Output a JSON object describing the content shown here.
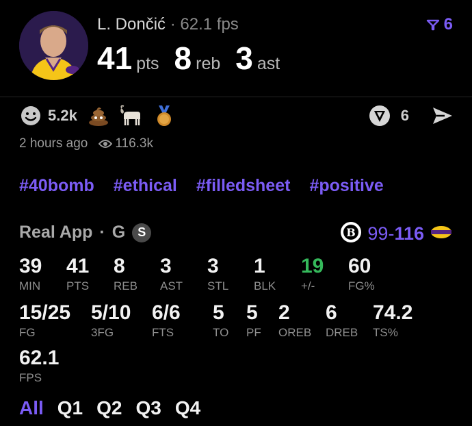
{
  "header": {
    "player_name": "L. Dončić",
    "separator": "·",
    "fps": "62.1 fps",
    "filter_count": "6",
    "statline": [
      {
        "value": "41",
        "label": "pts"
      },
      {
        "value": "8",
        "label": "reb"
      },
      {
        "value": "3",
        "label": "ast"
      }
    ]
  },
  "reactions": {
    "smile_count": "5.2k",
    "icons": [
      "smile-icon",
      "poop-emoji",
      "goat-emoji",
      "medal-emoji"
    ],
    "collection_count": "6"
  },
  "meta": {
    "time_ago": "2 hours ago",
    "views": "116.3k"
  },
  "tags": [
    "#40bomb",
    "#ethical",
    "#filledsheet",
    "#positive"
  ],
  "box": {
    "source": "Real App",
    "separator": "·",
    "position": "G",
    "badge": "S",
    "away_score": "99",
    "dash": "-",
    "home_score": "116",
    "colors": {
      "accent": "#7b5cf5",
      "positive": "#35b95b"
    },
    "row1": [
      {
        "value": "39",
        "label": "MIN"
      },
      {
        "value": "41",
        "label": "PTS"
      },
      {
        "value": "8",
        "label": "REB"
      },
      {
        "value": "3",
        "label": "AST"
      },
      {
        "value": "3",
        "label": "STL"
      },
      {
        "value": "1",
        "label": "BLK"
      },
      {
        "value": "19",
        "label": "+/-"
      },
      {
        "value": "60",
        "label": "FG%"
      }
    ],
    "row2": [
      {
        "value": "15/25",
        "label": "FG"
      },
      {
        "value": "5/10",
        "label": "3FG"
      },
      {
        "value": "6/6",
        "label": "FTS"
      },
      {
        "value": "5",
        "label": "TO"
      },
      {
        "value": "5",
        "label": "PF"
      },
      {
        "value": "2",
        "label": "OREB"
      },
      {
        "value": "6",
        "label": "DREB"
      },
      {
        "value": "74.2",
        "label": "TS%"
      }
    ],
    "row3": [
      {
        "value": "62.1",
        "label": "FPS"
      }
    ]
  },
  "periods": [
    "All",
    "Q1",
    "Q2",
    "Q3",
    "Q4"
  ]
}
